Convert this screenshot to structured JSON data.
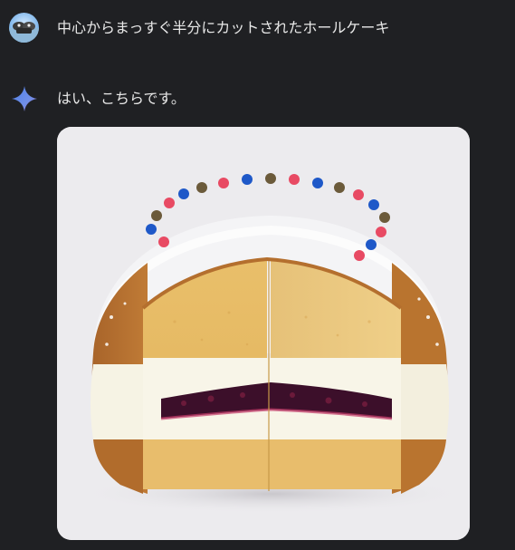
{
  "conversation": {
    "user_message": {
      "avatar_icon": "user-avatar-icon",
      "text": "中心からまっすぐ半分にカットされたホールケーキ"
    },
    "model_response": {
      "icon": "gemini-sparkle-icon",
      "text": "はい、こちらです。",
      "image": {
        "icon": "cake-image",
        "background_color": "#ecebee"
      }
    }
  },
  "colors": {
    "page_background": "#1f2023",
    "text": "#e8e8e8",
    "sparkle_blue": "#4f7fe8",
    "sparkle_purple": "#9b72cb"
  }
}
